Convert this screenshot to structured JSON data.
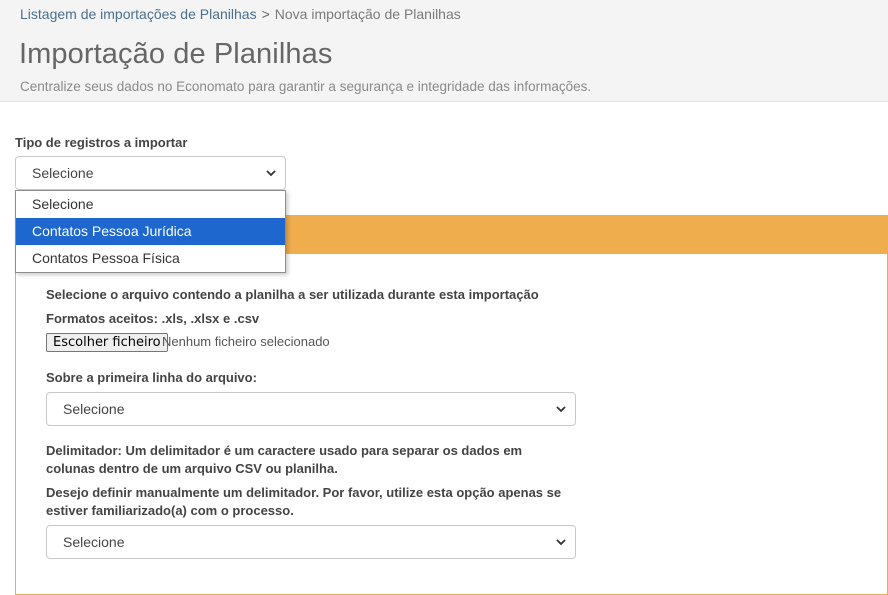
{
  "breadcrumb": {
    "parent": "Listagem de importações de Planilhas",
    "separator": ">",
    "current": "Nova importação de Planilhas"
  },
  "page": {
    "title": "Importação de Planilhas",
    "subtitle": "Centralize seus dados no Economato para garantir a segurança e integridade das informações."
  },
  "record_type": {
    "label": "Tipo de registros a importar",
    "selected": "Selecione",
    "options": [
      "Selecione",
      "Contatos Pessoa Jurídica",
      "Contatos Pessoa Física"
    ],
    "highlighted_index": 1
  },
  "file": {
    "instruction": "Selecione o arquivo contendo a planilha a ser utilizada durante esta importação",
    "formats": "Formatos aceitos: .xls, .xlsx e .csv",
    "button_label": "Escolher ficheiro",
    "status": "Nenhum ficheiro selecionado"
  },
  "first_line": {
    "label": "Sobre a primeira linha do arquivo:",
    "selected": "Selecione"
  },
  "delimiter": {
    "description_line1": "Delimitador: Um delimitador é um caractere usado para separar os dados em",
    "description_line2": "colunas dentro de um arquivo CSV ou planilha.",
    "manual_line1": "Desejo definir manualmente um delimitador. Por favor, utilize esta opção apenas se",
    "manual_line2": "estiver familiarizado(a) com o processo.",
    "selected": "Selecione"
  },
  "colors": {
    "panel_accent": "#f0ad4e",
    "highlight": "#1e67cf",
    "link": "#4a6f8f"
  }
}
